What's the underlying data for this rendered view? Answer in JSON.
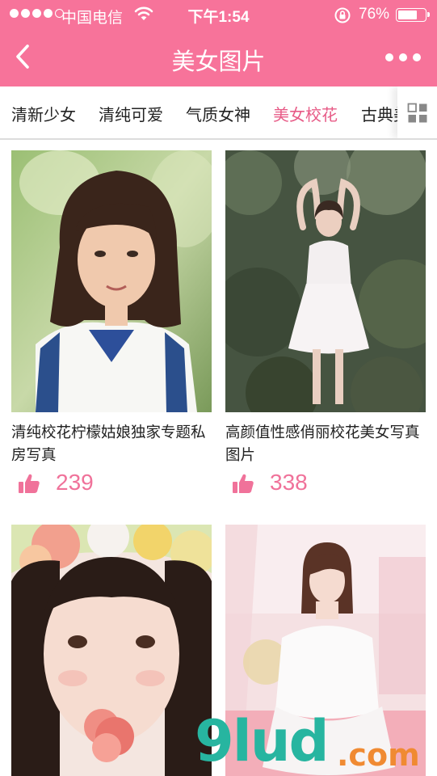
{
  "status_bar": {
    "carrier": "中国电信",
    "time": "下午1:54",
    "battery_percent": "76%",
    "battery_level": 0.76,
    "signal_bars_filled": 4,
    "signal_bars_total": 5
  },
  "nav": {
    "title": "美女图片",
    "back_icon": "chevron-left-icon",
    "more_icon": "more-dots-icon"
  },
  "tabs": {
    "items": [
      "清新少女",
      "清纯可爱",
      "气质女神",
      "美女校花",
      "古典美"
    ],
    "active_index": 3,
    "grid_icon": "grid-menu-icon"
  },
  "cards": [
    {
      "caption": "清纯校花柠檬姑娘独家专题私房写真",
      "likes": "239"
    },
    {
      "caption": "高颜值性感俏丽校花美女写真图片",
      "likes": "338"
    },
    {
      "caption": "",
      "likes": ""
    },
    {
      "caption": "",
      "likes": ""
    }
  ],
  "watermark": {
    "main": "9lud",
    "suffix": ".com"
  },
  "colors": {
    "brand": "#f7739a",
    "active_tab": "#e75b87",
    "like": "#f0729a"
  }
}
